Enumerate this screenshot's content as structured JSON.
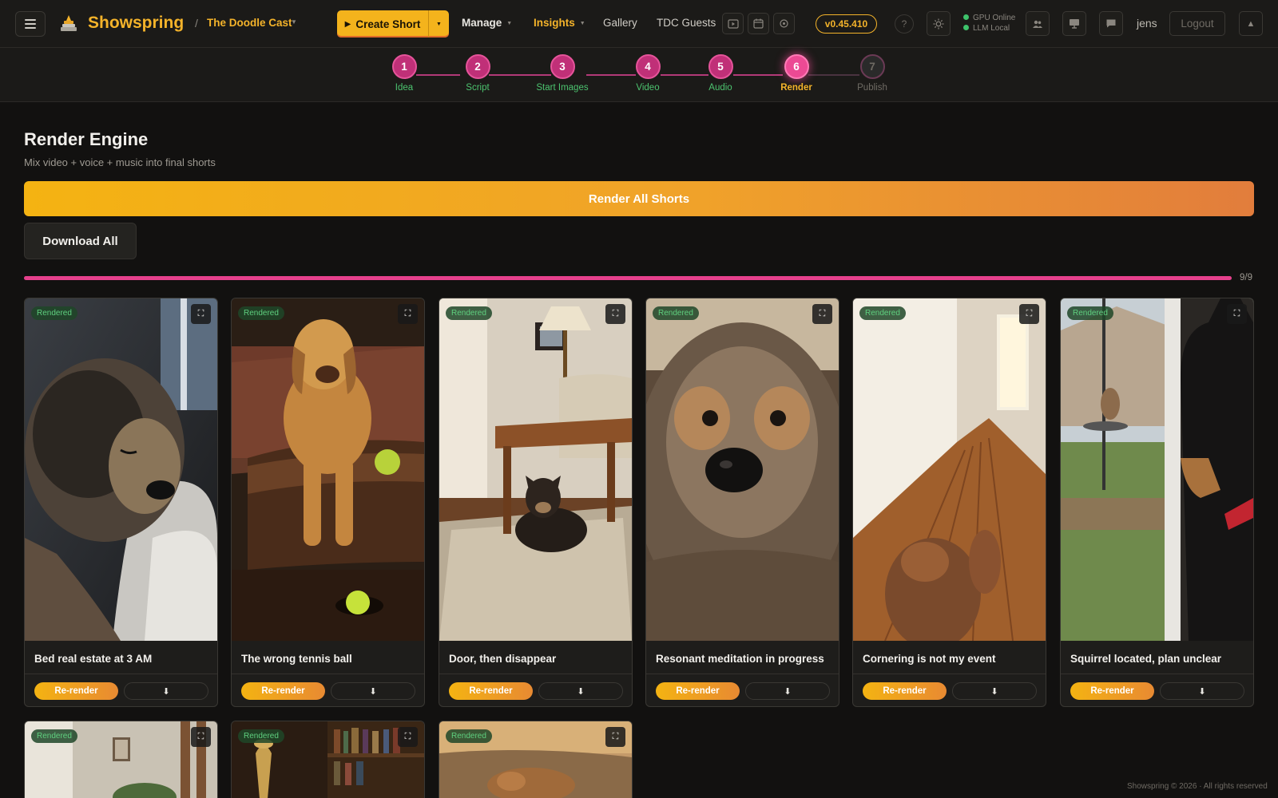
{
  "app": {
    "brand": "Showspring",
    "breadcrumb_sep": "/",
    "project": "The Doodle Cast",
    "version": "v0.45.410",
    "user": "jens",
    "logout_label": "Logout",
    "help_label": "?"
  },
  "nav": {
    "create_label": "Create Short",
    "items": [
      {
        "label": "Manage"
      },
      {
        "label": "Insights"
      },
      {
        "label": "Gallery"
      },
      {
        "label": "TDC Guests"
      }
    ]
  },
  "status": {
    "gpu": "GPU Online",
    "llm": "LLM Local",
    "dot_color": "#3ec26b"
  },
  "steps": [
    {
      "num": "1",
      "label": "Idea",
      "state": "done"
    },
    {
      "num": "2",
      "label": "Script",
      "state": "done"
    },
    {
      "num": "3",
      "label": "Start Images",
      "state": "done"
    },
    {
      "num": "4",
      "label": "Video",
      "state": "done"
    },
    {
      "num": "5",
      "label": "Audio",
      "state": "done"
    },
    {
      "num": "6",
      "label": "Render",
      "state": "active"
    },
    {
      "num": "7",
      "label": "Publish",
      "state": "pending"
    }
  ],
  "page": {
    "title": "Render Engine",
    "subtitle": "Mix video + voice + music into final shorts",
    "render_all_label": "Render All Shorts",
    "download_all_label": "Download All",
    "progress_text": "9/9",
    "progress_fraction": 1.0
  },
  "card_actions": {
    "badge": "Rendered",
    "rerender_label": "Re-render",
    "download_glyph": "⬇",
    "expand_glyph": "⛶"
  },
  "shorts": [
    {
      "title": "Bed real estate at 3 AM",
      "scene": "sleeping-dog"
    },
    {
      "title": "The wrong tennis ball",
      "scene": "dog-ottoman"
    },
    {
      "title": "Door, then disappear",
      "scene": "dog-under-table"
    },
    {
      "title": "Resonant meditation in progress",
      "scene": "dog-closeup"
    },
    {
      "title": "Cornering is not my event",
      "scene": "hallway"
    },
    {
      "title": "Squirrel located, plan unclear",
      "scene": "dog-window"
    },
    {
      "title": "",
      "scene": "window-room"
    },
    {
      "title": "",
      "scene": "bookshelf-lamp"
    },
    {
      "title": "",
      "scene": "dog-couch"
    }
  ],
  "footer": "Showspring © 2026 · All rights reserved",
  "colors": {
    "accent": "#f4b32a",
    "pink": "#e5408c",
    "success": "#4cc36f",
    "background": "#121110"
  }
}
